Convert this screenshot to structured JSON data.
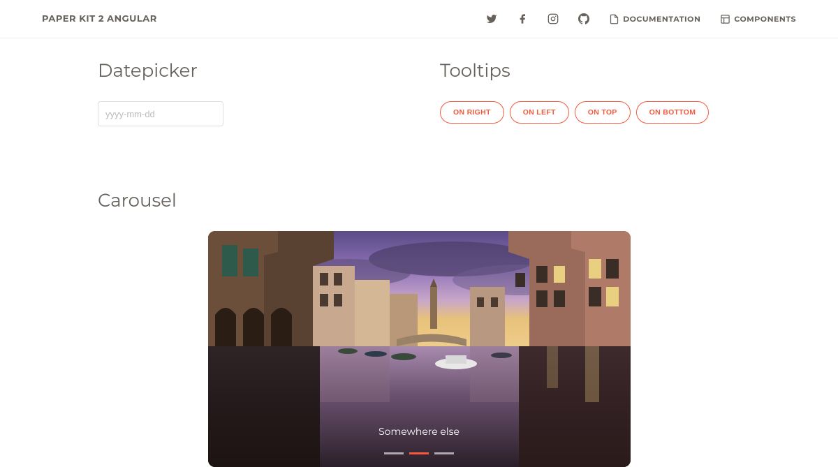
{
  "nav": {
    "brand": "PAPER KIT 2 ANGULAR",
    "documentation": "DOCUMENTATION",
    "components": "COMPONENTS"
  },
  "sections": {
    "datepicker": {
      "title": "Datepicker",
      "placeholder": "yyyy-mm-dd"
    },
    "tooltips": {
      "title": "Tooltips",
      "buttons": {
        "right": "ON RIGHT",
        "left": "ON LEFT",
        "top": "ON TOP",
        "bottom": "ON BOTTOM"
      }
    },
    "carousel": {
      "title": "Carousel",
      "caption": "Somewhere else",
      "active_index": 1,
      "slides_count": 3
    }
  },
  "colors": {
    "accent": "#f5593d",
    "text": "#66615b"
  }
}
